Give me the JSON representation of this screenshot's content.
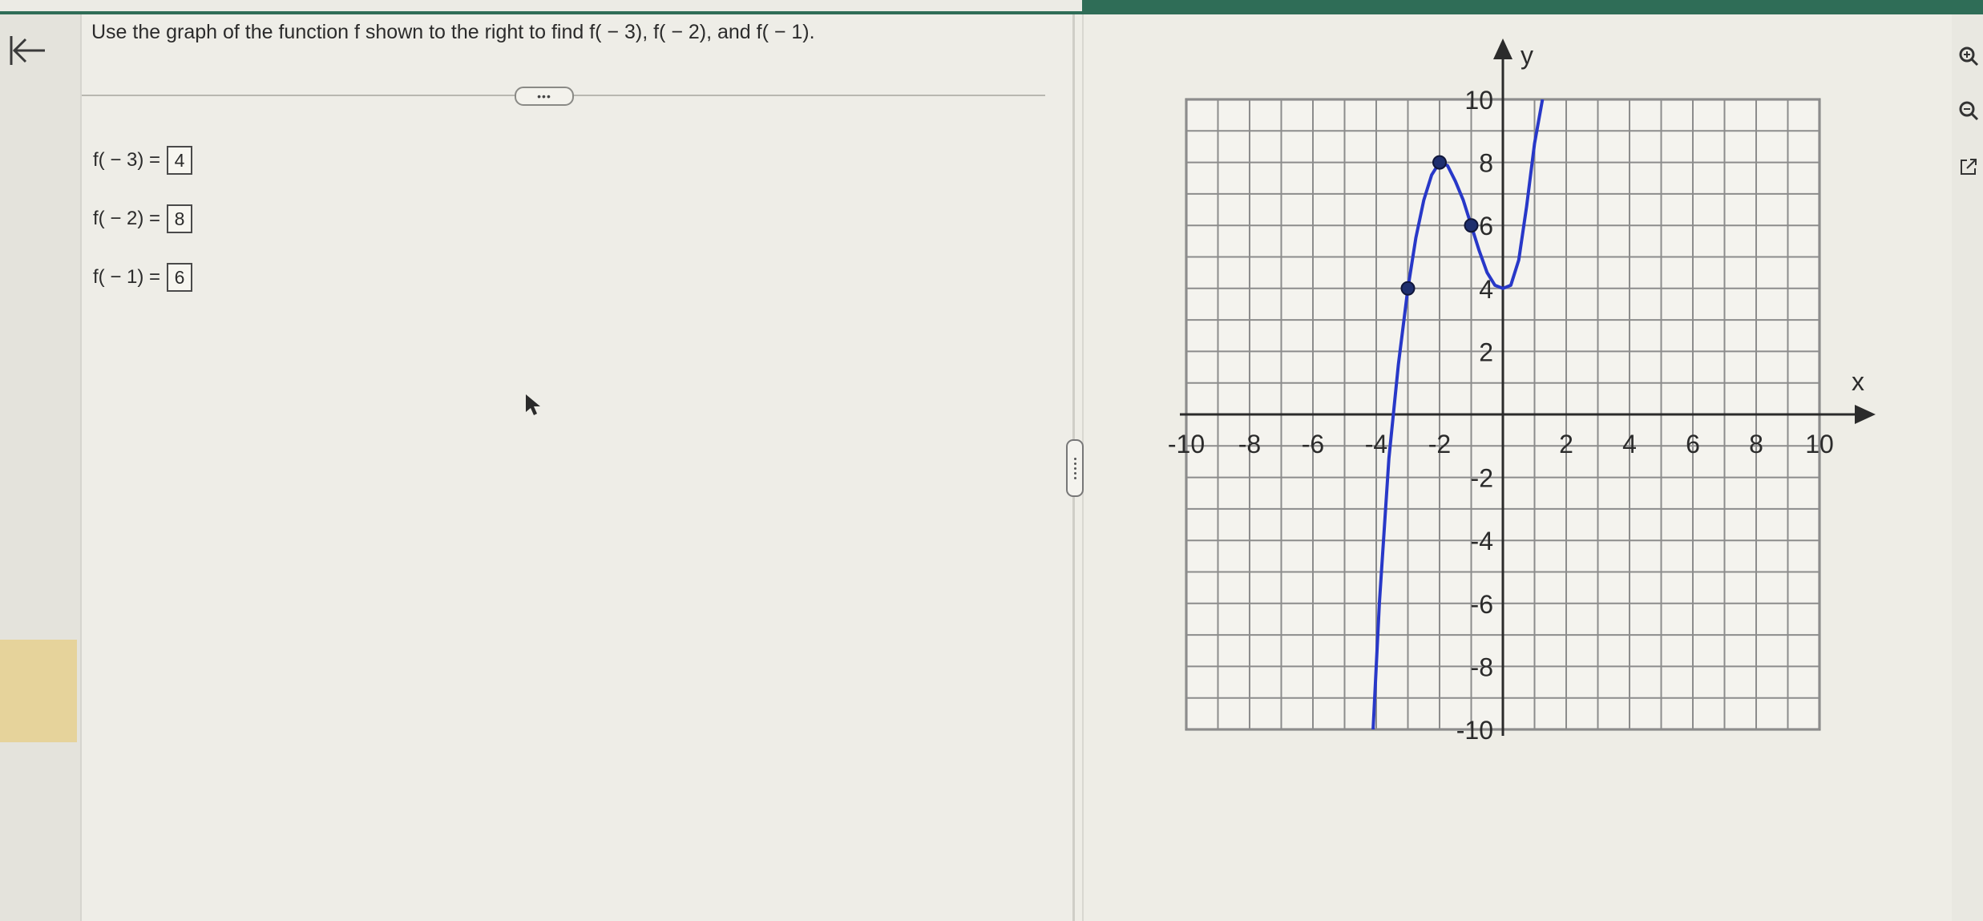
{
  "question": {
    "text": "Use the graph of the function f shown to the right to find f( − 3), f( − 2), and f( − 1)."
  },
  "answers": [
    {
      "label": "f( − 3) =",
      "value": "4"
    },
    {
      "label": "f( − 2) =",
      "value": "8"
    },
    {
      "label": "f( − 1) =",
      "value": "6"
    }
  ],
  "more_button": {
    "label": "•••"
  },
  "icons": {
    "back": "collapse-left-arrow-icon",
    "zoom_in": "zoom-in-icon",
    "zoom_out": "zoom-out-icon",
    "popout": "external-link-icon",
    "splitter": "panel-splitter-handle"
  },
  "colors": {
    "curve": "#2838c8",
    "highlight": "#e6d39b",
    "topbar": "#2f6d57"
  },
  "chart_data": {
    "type": "line",
    "xlabel": "x",
    "ylabel": "y",
    "xlim": [
      -10,
      10
    ],
    "ylim": [
      -10,
      10
    ],
    "grid": true,
    "x_ticks": [
      "-10",
      "-8",
      "-6",
      "-4",
      "-2",
      "2",
      "4",
      "6",
      "8",
      "10"
    ],
    "y_ticks": [
      "10",
      "8",
      "6",
      "4",
      "2",
      "-2",
      "-4",
      "-6",
      "-8",
      "-10"
    ],
    "series": [
      {
        "x": [
          -4.1,
          -3.9,
          -3.6,
          -3.3,
          -3.0,
          -2.75,
          -2.5,
          -2.25,
          -2.0,
          -1.75,
          -1.5,
          -1.25,
          -1.0,
          -0.75,
          -0.5,
          -0.25,
          0.0,
          0.25,
          0.5,
          0.75,
          1.0,
          1.25
        ],
        "y": [
          -10.0,
          -6.0,
          -1.4,
          1.6,
          4.0,
          5.6,
          6.8,
          7.6,
          8.0,
          7.9,
          7.4,
          6.8,
          6.0,
          5.2,
          4.5,
          4.1,
          4.0,
          4.1,
          4.9,
          6.6,
          8.6,
          10.0
        ]
      }
    ],
    "points": [
      {
        "x": -3,
        "y": 4
      },
      {
        "x": -2,
        "y": 8
      },
      {
        "x": -1,
        "y": 6
      }
    ]
  }
}
